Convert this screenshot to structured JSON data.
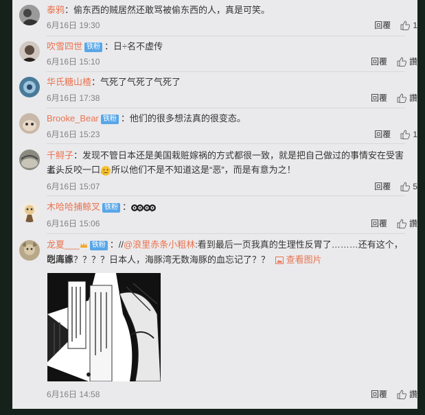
{
  "comments": [
    {
      "name": "泰鸦",
      "badge": "",
      "text": "：偷东西的贼居然还敢骂被偷东西的人，真是可笑。",
      "time": "6月16日 19:30",
      "reply": "回覆",
      "like": "1"
    },
    {
      "name": "吹雪四世",
      "badge": "铁粉",
      "text": "：日÷名不虚传",
      "time": "6月16日 15:10",
      "reply": "回覆",
      "like": "讚"
    },
    {
      "name": "华氏糖山楂",
      "badge": "",
      "text": "：气死了气死了气死了",
      "time": "6月16日 17:38",
      "reply": "回覆",
      "like": "讚"
    },
    {
      "name": "Brooke_Bear",
      "badge": "铁粉",
      "text": "：他们的很多想法真的很变态。",
      "time": "6月16日 15:23",
      "reply": "回覆",
      "like": "1"
    },
    {
      "name": "千鲟子",
      "badge": "",
      "text": "：发现不管日本还是美国栽赃嫁祸的方式都很一致，就是把自己做过的事情安在受害者头",
      "text2a": "上，反咬一口",
      "text2b": "所以他们不是不知道这是“恶”，而是有意为之！",
      "time": "6月16日 15:07",
      "reply": "回覆",
      "like": "5"
    },
    {
      "name": "木哈哈捕鲸叉",
      "badge": "铁粉",
      "text": "：",
      "time": "6月16日 15:06",
      "reply": "回覆",
      "like": "讚"
    },
    {
      "name": "龙夏___",
      "badge": "铁粉",
      "text": "：//",
      "mention": "@浪里赤条小粗林",
      "text_b": ":看到最后一页我真的生理性反胃了………还有这个，到底谁",
      "text2": "吃海豚？？？？日本人，海豚湾无数海豚的血忘记了？？",
      "view_image": "查看图片",
      "time": "6月16日 14:58",
      "reply": "回覆",
      "like": "讚"
    }
  ],
  "colors": {
    "name": "#eb7350",
    "badge": "#58a6e8",
    "panel": "#eaeaec"
  }
}
